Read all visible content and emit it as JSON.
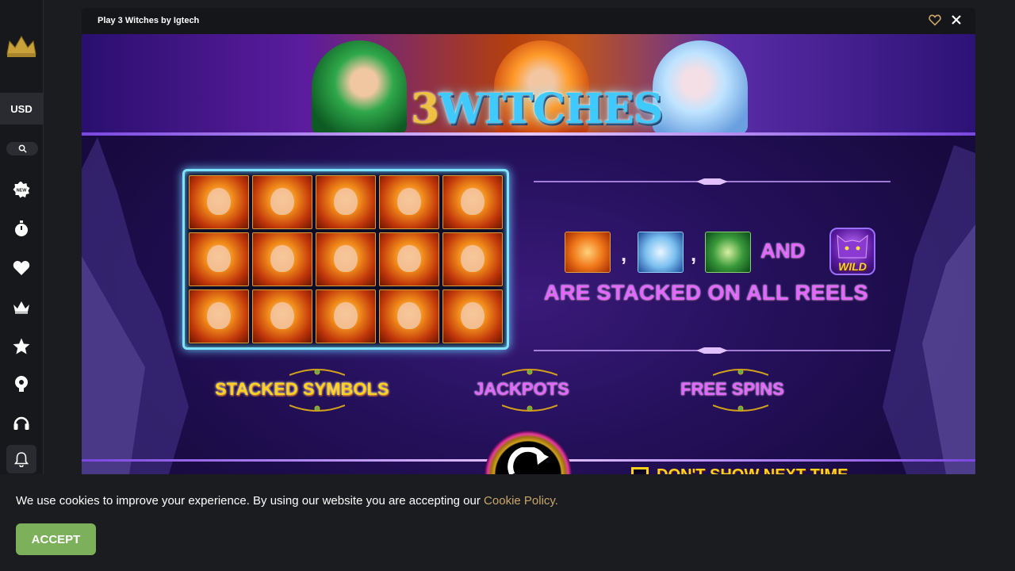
{
  "sidebar": {
    "currency": "USD",
    "icons": [
      "crown-logo-icon",
      "search-icon",
      "new-badge-icon",
      "stopwatch-icon",
      "heart-icon",
      "crown-icon",
      "star-icon",
      "trophy-icon",
      "headset-icon",
      "bell-icon"
    ]
  },
  "game_window": {
    "title": "Play 3 Witches by Igtech",
    "logo_number": "3",
    "logo_text": "WITCHES",
    "colors": {
      "accent_pink": "#e266ff",
      "accent_gold": "#ffd21a",
      "frame_cyan": "#7fe3ff"
    }
  },
  "splash": {
    "comma_1": ",",
    "comma_2": ",",
    "and_label": "AND",
    "wild_label": "WILD",
    "stacked_line": "ARE STACKED ON ALL REELS",
    "features": [
      "STACKED SYMBOLS",
      "JACKPOTS",
      "FREE SPINS"
    ],
    "dont_show": "DON'T SHOW NEXT TIME"
  },
  "cookie": {
    "text": "We use cookies to improve your experience. By using our website you are accepting our ",
    "link": "Cookie Policy.",
    "accept": "ACCEPT"
  }
}
